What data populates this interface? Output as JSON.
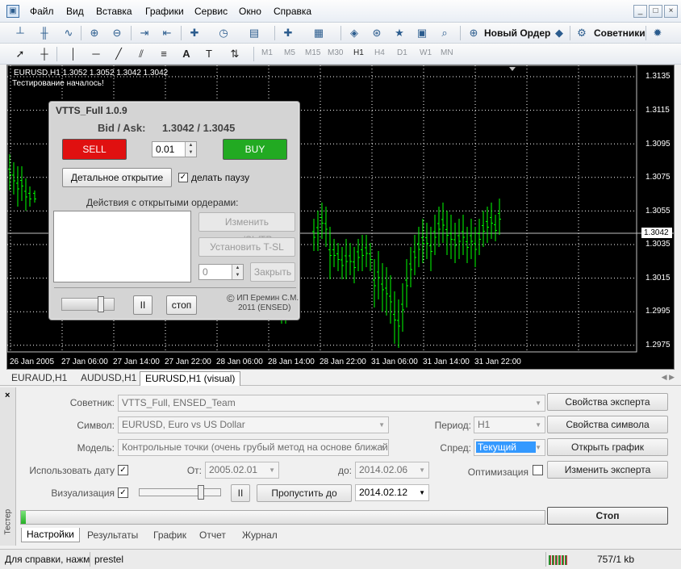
{
  "menu": {
    "items": [
      "Файл",
      "Вид",
      "Вставка",
      "Графики",
      "Сервис",
      "Окно",
      "Справка"
    ]
  },
  "window_controls": [
    "_",
    "□",
    "×"
  ],
  "toolbar": {
    "new_order": "Новый Ордер",
    "experts": "Советники",
    "timeframes": [
      "M1",
      "M5",
      "M15",
      "M30",
      "H1",
      "H4",
      "D1",
      "W1",
      "MN"
    ],
    "active_timeframe": "H1"
  },
  "chart": {
    "header": "EURUSD,H1  1.3052 1.3052 1.3042 1.3042",
    "status": "Тестирование началось!",
    "y_ticks": [
      "1.3135",
      "1.3115",
      "1.3095",
      "1.3075",
      "1.3055",
      "1.3035",
      "1.3015",
      "1.2995",
      "1.2975"
    ],
    "price_tag": "1.3042",
    "x_ticks": [
      "26 Jan 2005",
      "27 Jan 06:00",
      "27 Jan 14:00",
      "27 Jan 22:00",
      "28 Jan 06:00",
      "28 Jan 14:00",
      "28 Jan 22:00",
      "31 Jan 06:00",
      "31 Jan 14:00",
      "31 Jan 22:00"
    ],
    "bar_color": "#00ff00",
    "background_color": "#000000"
  },
  "panel": {
    "title": "VTTS_Full 1.0.9",
    "bidask_label": "Bid / Ask:",
    "bidask_value": "1.3042 / 1.3045",
    "sell": "SELL",
    "buy": "BUY",
    "lot": "0.01",
    "detail_button": "Детальное открытие",
    "pause_check": "✓",
    "pause_label": "делать паузу",
    "orders_label": "Действия с открытыми ордерами:",
    "modify_button": "Изменить цену/SL/TP",
    "tsl_button": "Установить T-SL",
    "close_value": "0",
    "close_button": "Закрыть",
    "pause_button": "II",
    "stop_button": "стоп",
    "copyright_symbol": "©",
    "copyright_line1": "ИП Еремин С.М.",
    "copyright_line2": "2011 (ENSED)",
    "sell_color": "#e01010",
    "buy_color": "#22aa22"
  },
  "chart_tabs": [
    "EURAUD,H1",
    "AUDUSD,H1",
    "EURUSD,H1 (visual)"
  ],
  "tester": {
    "side_label": "Тестер",
    "close": "×",
    "expert_label": "Советник:",
    "expert_value": "VTTS_Full, ENSED_Team",
    "symbol_label": "Символ:",
    "symbol_value": "EURUSD, Euro vs US Dollar",
    "model_label": "Модель:",
    "model_value": "Контрольные точки (очень грубый метод на основе ближайш",
    "use_date_label": "Использовать дату",
    "use_date_check": "✓",
    "from_label": "От:",
    "from_value": "2005.02.01",
    "to_label": "до:",
    "to_value": "2014.02.06",
    "visual_label": "Визуализация",
    "visual_check": "✓",
    "pause_button": "II",
    "skip_button": "Пропустить до",
    "skip_value": "2014.02.12",
    "period_label": "Период:",
    "period_value": "H1",
    "spread_label": "Спред:",
    "spread_value": "Текущий",
    "optimization_label": "Оптимизация",
    "expert_props": "Свойства эксперта",
    "symbol_props": "Свойства символа",
    "open_chart": "Открыть график",
    "modify_expert": "Изменить эксперта",
    "stop": "Стоп",
    "progress": 0.01,
    "tabs": [
      "Настройки",
      "Результаты",
      "График",
      "Отчет",
      "Журнал"
    ]
  },
  "statusbar": {
    "help": "Для справки, нажм",
    "profile": "prestel",
    "traffic": "757/1 kb"
  }
}
